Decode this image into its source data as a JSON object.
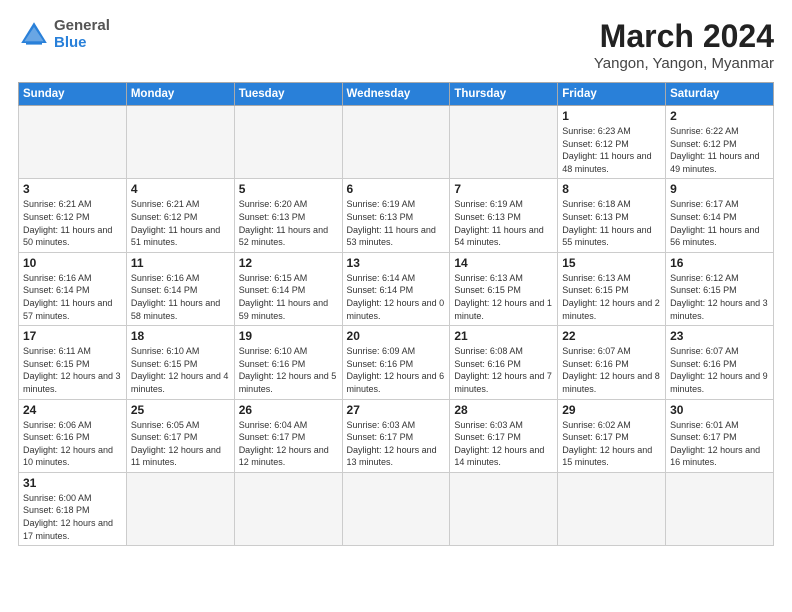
{
  "header": {
    "logo_general": "General",
    "logo_blue": "Blue",
    "month_title": "March 2024",
    "subtitle": "Yangon, Yangon, Myanmar"
  },
  "weekdays": [
    "Sunday",
    "Monday",
    "Tuesday",
    "Wednesday",
    "Thursday",
    "Friday",
    "Saturday"
  ],
  "weeks": [
    [
      {
        "day": "",
        "info": ""
      },
      {
        "day": "",
        "info": ""
      },
      {
        "day": "",
        "info": ""
      },
      {
        "day": "",
        "info": ""
      },
      {
        "day": "",
        "info": ""
      },
      {
        "day": "1",
        "info": "Sunrise: 6:23 AM\nSunset: 6:12 PM\nDaylight: 11 hours\nand 48 minutes."
      },
      {
        "day": "2",
        "info": "Sunrise: 6:22 AM\nSunset: 6:12 PM\nDaylight: 11 hours\nand 49 minutes."
      }
    ],
    [
      {
        "day": "3",
        "info": "Sunrise: 6:21 AM\nSunset: 6:12 PM\nDaylight: 11 hours\nand 50 minutes."
      },
      {
        "day": "4",
        "info": "Sunrise: 6:21 AM\nSunset: 6:12 PM\nDaylight: 11 hours\nand 51 minutes."
      },
      {
        "day": "5",
        "info": "Sunrise: 6:20 AM\nSunset: 6:13 PM\nDaylight: 11 hours\nand 52 minutes."
      },
      {
        "day": "6",
        "info": "Sunrise: 6:19 AM\nSunset: 6:13 PM\nDaylight: 11 hours\nand 53 minutes."
      },
      {
        "day": "7",
        "info": "Sunrise: 6:19 AM\nSunset: 6:13 PM\nDaylight: 11 hours\nand 54 minutes."
      },
      {
        "day": "8",
        "info": "Sunrise: 6:18 AM\nSunset: 6:13 PM\nDaylight: 11 hours\nand 55 minutes."
      },
      {
        "day": "9",
        "info": "Sunrise: 6:17 AM\nSunset: 6:14 PM\nDaylight: 11 hours\nand 56 minutes."
      }
    ],
    [
      {
        "day": "10",
        "info": "Sunrise: 6:16 AM\nSunset: 6:14 PM\nDaylight: 11 hours\nand 57 minutes."
      },
      {
        "day": "11",
        "info": "Sunrise: 6:16 AM\nSunset: 6:14 PM\nDaylight: 11 hours\nand 58 minutes."
      },
      {
        "day": "12",
        "info": "Sunrise: 6:15 AM\nSunset: 6:14 PM\nDaylight: 11 hours\nand 59 minutes."
      },
      {
        "day": "13",
        "info": "Sunrise: 6:14 AM\nSunset: 6:14 PM\nDaylight: 12 hours\nand 0 minutes."
      },
      {
        "day": "14",
        "info": "Sunrise: 6:13 AM\nSunset: 6:15 PM\nDaylight: 12 hours\nand 1 minute."
      },
      {
        "day": "15",
        "info": "Sunrise: 6:13 AM\nSunset: 6:15 PM\nDaylight: 12 hours\nand 2 minutes."
      },
      {
        "day": "16",
        "info": "Sunrise: 6:12 AM\nSunset: 6:15 PM\nDaylight: 12 hours\nand 3 minutes."
      }
    ],
    [
      {
        "day": "17",
        "info": "Sunrise: 6:11 AM\nSunset: 6:15 PM\nDaylight: 12 hours\nand 3 minutes."
      },
      {
        "day": "18",
        "info": "Sunrise: 6:10 AM\nSunset: 6:15 PM\nDaylight: 12 hours\nand 4 minutes."
      },
      {
        "day": "19",
        "info": "Sunrise: 6:10 AM\nSunset: 6:16 PM\nDaylight: 12 hours\nand 5 minutes."
      },
      {
        "day": "20",
        "info": "Sunrise: 6:09 AM\nSunset: 6:16 PM\nDaylight: 12 hours\nand 6 minutes."
      },
      {
        "day": "21",
        "info": "Sunrise: 6:08 AM\nSunset: 6:16 PM\nDaylight: 12 hours\nand 7 minutes."
      },
      {
        "day": "22",
        "info": "Sunrise: 6:07 AM\nSunset: 6:16 PM\nDaylight: 12 hours\nand 8 minutes."
      },
      {
        "day": "23",
        "info": "Sunrise: 6:07 AM\nSunset: 6:16 PM\nDaylight: 12 hours\nand 9 minutes."
      }
    ],
    [
      {
        "day": "24",
        "info": "Sunrise: 6:06 AM\nSunset: 6:16 PM\nDaylight: 12 hours\nand 10 minutes."
      },
      {
        "day": "25",
        "info": "Sunrise: 6:05 AM\nSunset: 6:17 PM\nDaylight: 12 hours\nand 11 minutes."
      },
      {
        "day": "26",
        "info": "Sunrise: 6:04 AM\nSunset: 6:17 PM\nDaylight: 12 hours\nand 12 minutes."
      },
      {
        "day": "27",
        "info": "Sunrise: 6:03 AM\nSunset: 6:17 PM\nDaylight: 12 hours\nand 13 minutes."
      },
      {
        "day": "28",
        "info": "Sunrise: 6:03 AM\nSunset: 6:17 PM\nDaylight: 12 hours\nand 14 minutes."
      },
      {
        "day": "29",
        "info": "Sunrise: 6:02 AM\nSunset: 6:17 PM\nDaylight: 12 hours\nand 15 minutes."
      },
      {
        "day": "30",
        "info": "Sunrise: 6:01 AM\nSunset: 6:17 PM\nDaylight: 12 hours\nand 16 minutes."
      }
    ],
    [
      {
        "day": "31",
        "info": "Sunrise: 6:00 AM\nSunset: 6:18 PM\nDaylight: 12 hours\nand 17 minutes."
      },
      {
        "day": "",
        "info": ""
      },
      {
        "day": "",
        "info": ""
      },
      {
        "day": "",
        "info": ""
      },
      {
        "day": "",
        "info": ""
      },
      {
        "day": "",
        "info": ""
      },
      {
        "day": "",
        "info": ""
      }
    ]
  ]
}
